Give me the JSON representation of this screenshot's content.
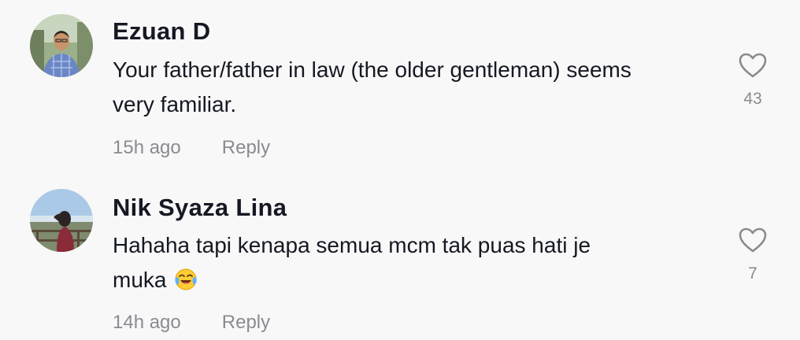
{
  "comments": [
    {
      "username": "Ezuan D",
      "line1": "Your father/father in law (the older gentleman) seems",
      "line2": "very familiar.",
      "time": "15h ago",
      "reply_label": "Reply",
      "likes": "43"
    },
    {
      "username": "Nik Syaza Lina",
      "line1": "Hahaha tapi kenapa semua mcm tak puas hati je",
      "line2": "muka",
      "emoji": "face-with-tears-of-joy",
      "time": "14h ago",
      "reply_label": "Reply",
      "likes": "7"
    }
  ],
  "colors": {
    "text": "#161823",
    "secondary": "#8a8b91",
    "background": "#f8f8f8"
  }
}
